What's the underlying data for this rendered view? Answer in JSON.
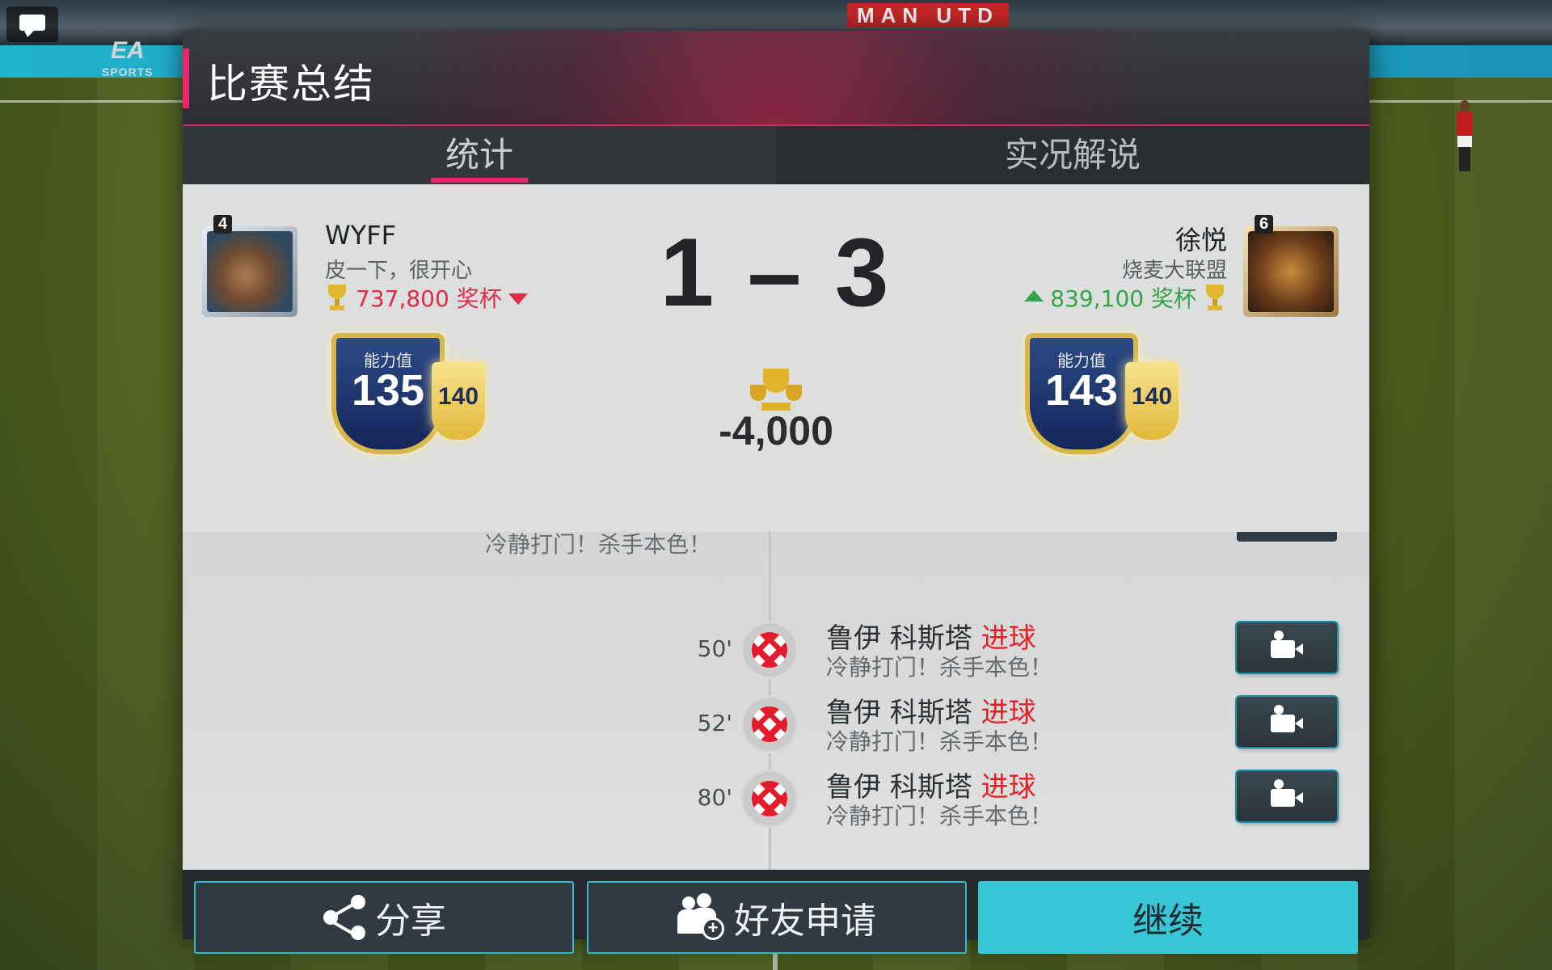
{
  "header": {
    "title": "比赛总结"
  },
  "tabs": [
    {
      "label": "统计",
      "active": true
    },
    {
      "label": "实况解说",
      "active": false
    }
  ],
  "home": {
    "level": "4",
    "name": "WYFF",
    "club": "皮一下，很开心",
    "trophies": "737,800 奖杯",
    "trend": "down",
    "rating_label": "能力值",
    "rating": "135",
    "sub_rating": "140"
  },
  "away": {
    "level": "6",
    "name": "徐悦",
    "club": "烧麦大联盟",
    "trophies": "839,100 奖杯",
    "trend": "up",
    "rating_label": "能力值",
    "rating": "143",
    "sub_rating": "140"
  },
  "score": "1 – 3",
  "trophy_change": "-4,000",
  "timeline": {
    "partial_text": "冷静打门！杀手本色！",
    "events": [
      {
        "minute": "50'",
        "player": "鲁伊 科斯塔",
        "event": "进球",
        "comment": "冷静打门！杀手本色！"
      },
      {
        "minute": "52'",
        "player": "鲁伊 科斯塔",
        "event": "进球",
        "comment": "冷静打门！杀手本色！"
      },
      {
        "minute": "80'",
        "player": "鲁伊 科斯塔",
        "event": "进球",
        "comment": "冷静打门！杀手本色！"
      }
    ]
  },
  "footer": {
    "share_label": "分享",
    "friend_label": "好友申请",
    "continue_label": "继续"
  },
  "background": {
    "banner_text": "MAN UTD",
    "ad_logo": "EA",
    "ad_logo_sub": "SPORTS"
  },
  "colors": {
    "accent": "#e8286b",
    "primary_button": "#37c6d3",
    "goal_text": "#e02229",
    "trophy_up": "#35a34b",
    "trophy_down": "#e02b4a"
  }
}
